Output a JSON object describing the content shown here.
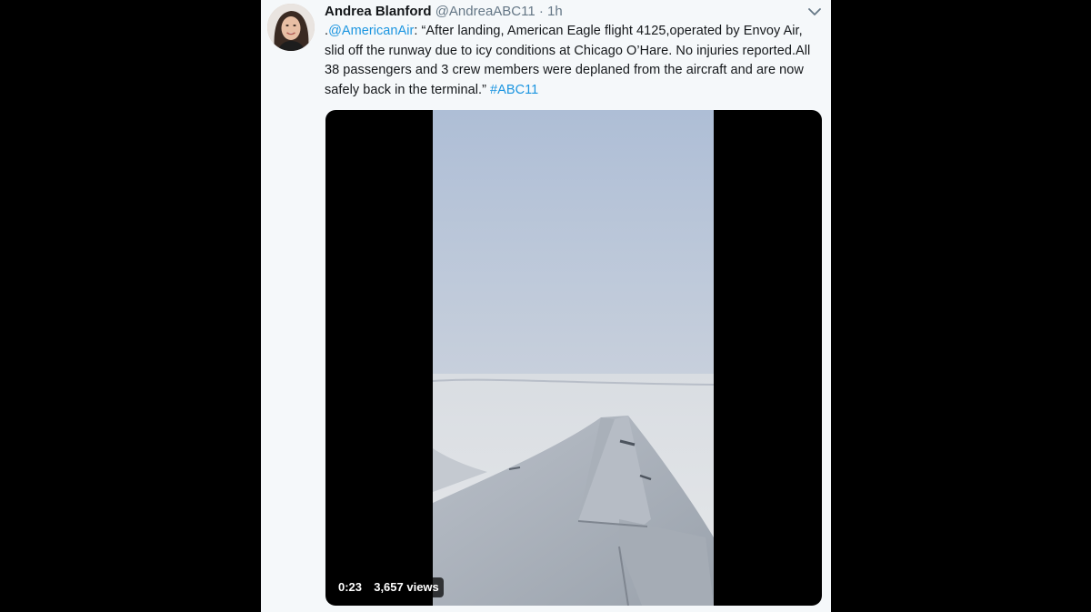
{
  "tweet": {
    "author_name": "Andrea Blanford",
    "handle": "@AndreaABC11",
    "separator": "·",
    "time": "1h",
    "text": {
      "prefix": ".",
      "mention": "@AmericanAir",
      "body": ": “After landing, American Eagle flight 4125,operated by Envoy Air, slid off the runway due to icy conditions at Chicago O’Hare. No injuries reported.All 38 passengers and 3 crew members were deplaned from the aircraft and are now safely back in the terminal.” ",
      "hashtag": "#ABC11"
    },
    "menu_icon": "chevron-down-icon"
  },
  "video": {
    "duration": "0:23",
    "views": "3,657 views"
  },
  "colors": {
    "background": "#000000",
    "card": "#f5f8fa",
    "text": "#14171a",
    "secondary_text": "#657786",
    "link": "#1b95e0"
  }
}
